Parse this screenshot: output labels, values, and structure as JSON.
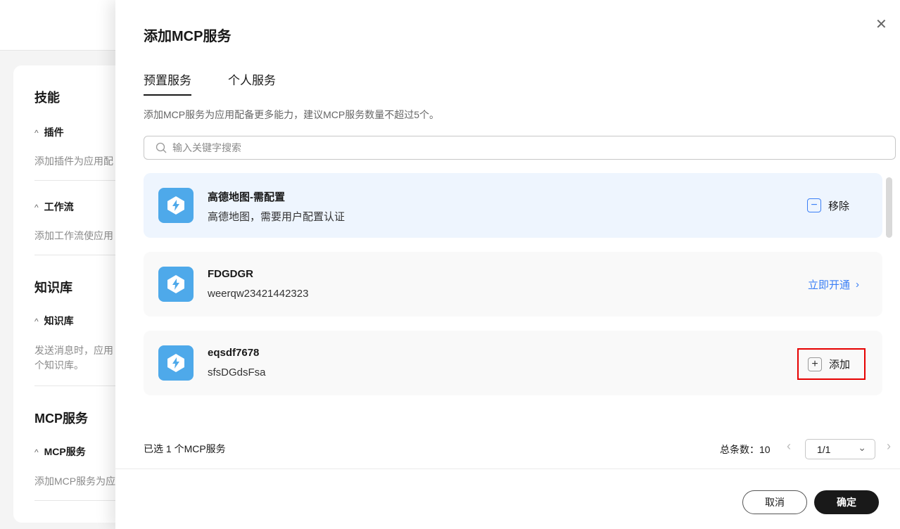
{
  "left": {
    "skills": "技能",
    "plugin": "插件",
    "plugin_desc": "添加插件为应用配",
    "workflow": "工作流",
    "workflow_desc": "添加工作流使应用",
    "kb_title": "知识库",
    "kb": "知识库",
    "kb_desc": "发送消息时，应用\n个知识库。",
    "mcp_title": "MCP服务",
    "mcp": "MCP服务",
    "mcp_desc": "添加MCP服务为应"
  },
  "drawer": {
    "title": "添加MCP服务",
    "tabs": [
      "预置服务",
      "个人服务"
    ],
    "desc": "添加MCP服务为应用配备更多能力，建议MCP服务数量不超过5个。",
    "search_placeholder": "输入关键字搜索",
    "items": [
      {
        "name": "高德地图-需配置",
        "desc": "高德地图，需要用户配置认证",
        "action": "移除"
      },
      {
        "name": "FDGDGR",
        "desc": "weerqw23421442323",
        "action": "立即开通"
      },
      {
        "name": "eqsdf7678",
        "desc": "sfsDGdsFsa",
        "action": "添加"
      }
    ],
    "selected": "已选 1 个MCP服务",
    "total": "总条数：10",
    "page": "1/1",
    "cancel": "取消",
    "ok": "确定"
  },
  "colors": {
    "accent": "#3a7ff6",
    "logo": "#4ea9ea"
  }
}
